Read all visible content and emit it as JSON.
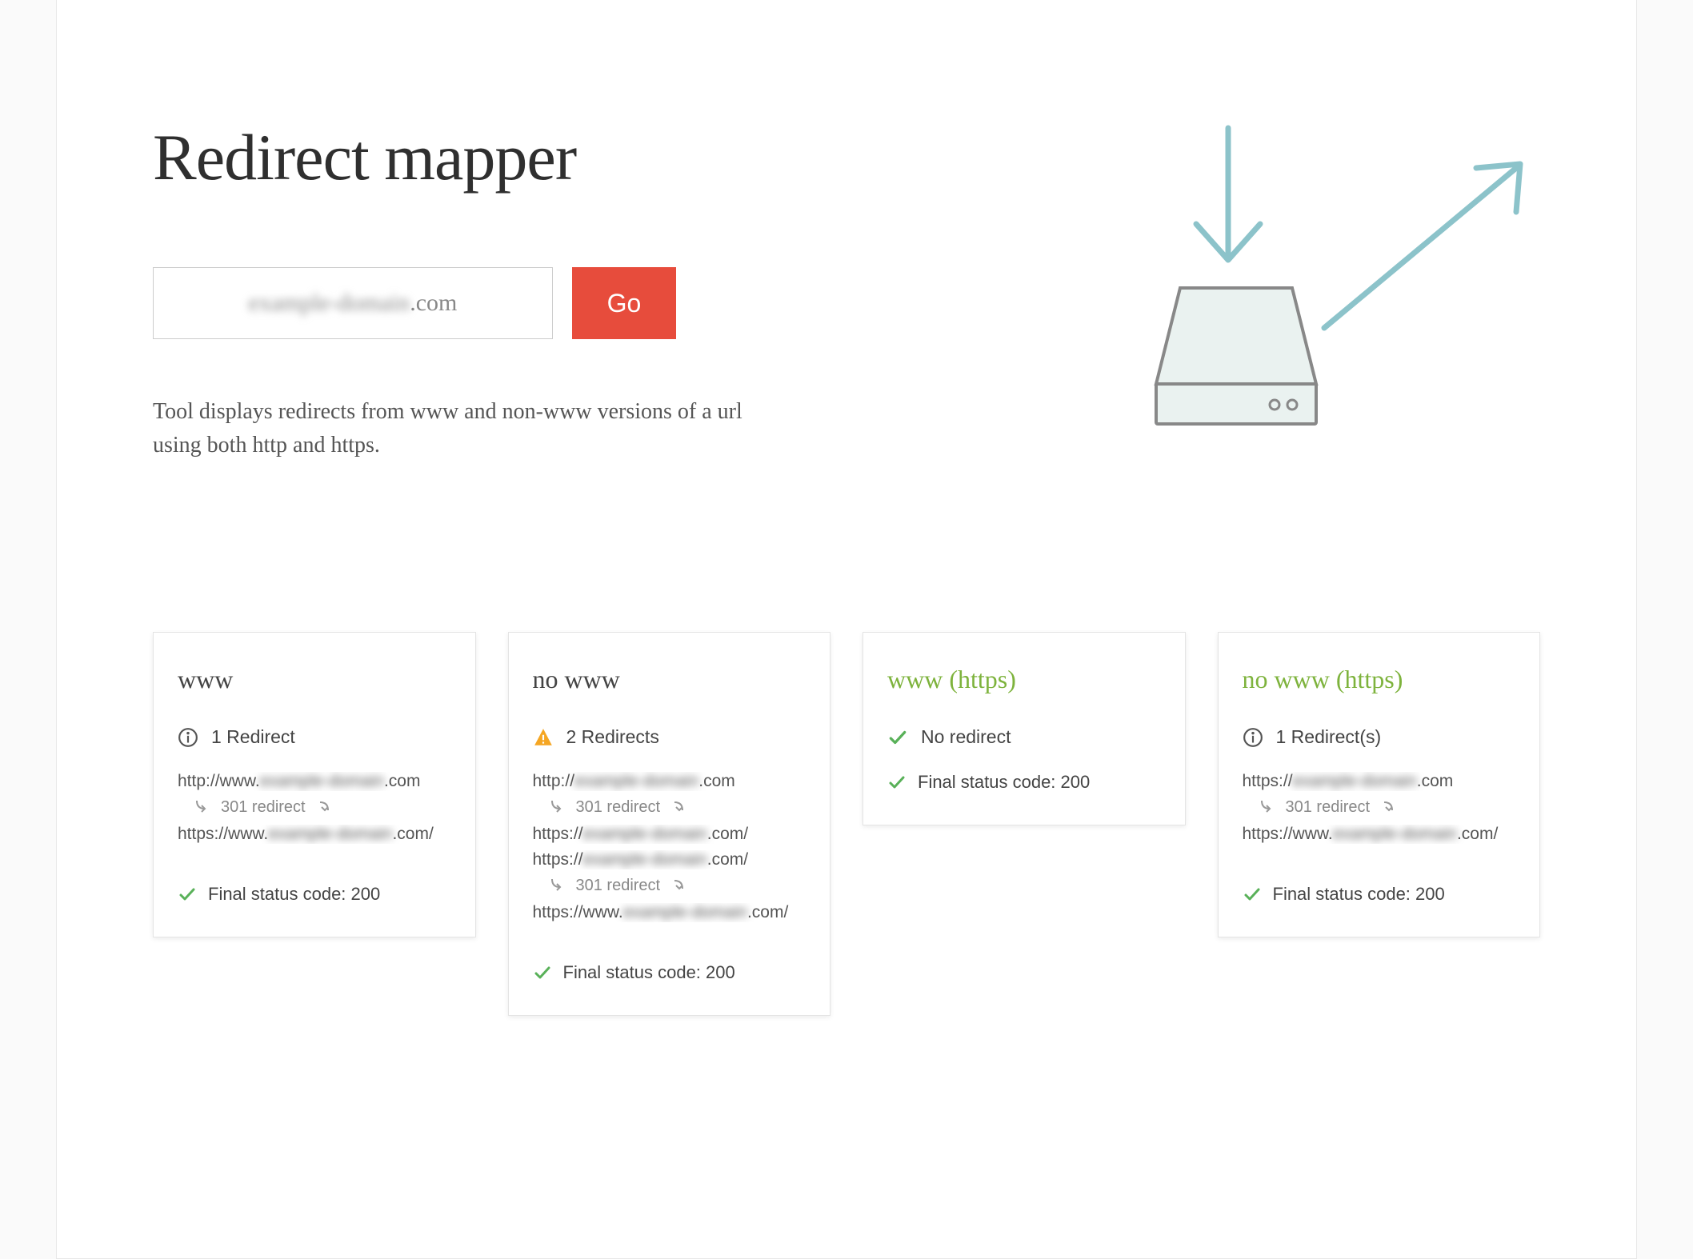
{
  "page": {
    "title": "Redirect mapper",
    "description": "Tool displays redirects from www and non-www versions of a url using both http and https.",
    "input_value": "example-domain.com",
    "go_label": "Go"
  },
  "colors": {
    "accent_red": "#e74c3c",
    "accent_green": "#7eb33d",
    "check_green": "#59b159",
    "warn_orange": "#f5a623"
  },
  "cards": [
    {
      "title": "www",
      "secure": false,
      "status_icon": "info",
      "status_text": "1 Redirect",
      "chain": [
        {
          "type": "url",
          "text": "http://www.example-domain.com"
        },
        {
          "type": "redirect",
          "text": "301 redirect"
        },
        {
          "type": "url",
          "text": "https://www.example-domain.com/"
        }
      ],
      "final": "Final status code: 200"
    },
    {
      "title": "no www",
      "secure": false,
      "status_icon": "warn",
      "status_text": "2 Redirects",
      "chain": [
        {
          "type": "url",
          "text": "http://example-domain.com"
        },
        {
          "type": "redirect",
          "text": "301 redirect"
        },
        {
          "type": "url",
          "text": "https://example-domain.com/"
        },
        {
          "type": "url",
          "text": "https://example-domain.com/"
        },
        {
          "type": "redirect",
          "text": "301 redirect"
        },
        {
          "type": "url",
          "text": "https://www.example-domain.com/"
        }
      ],
      "final": "Final status code: 200"
    },
    {
      "title": "www (https)",
      "secure": true,
      "status_icon": "check",
      "status_text": "No redirect",
      "chain": [],
      "final": "Final status code: 200"
    },
    {
      "title": "no www (https)",
      "secure": true,
      "status_icon": "info",
      "status_text": "1 Redirect(s)",
      "chain": [
        {
          "type": "url",
          "text": "https://example-domain.com"
        },
        {
          "type": "redirect",
          "text": "301 redirect"
        },
        {
          "type": "url",
          "text": "https://www.example-domain.com/"
        }
      ],
      "final": "Final status code: 200"
    }
  ]
}
